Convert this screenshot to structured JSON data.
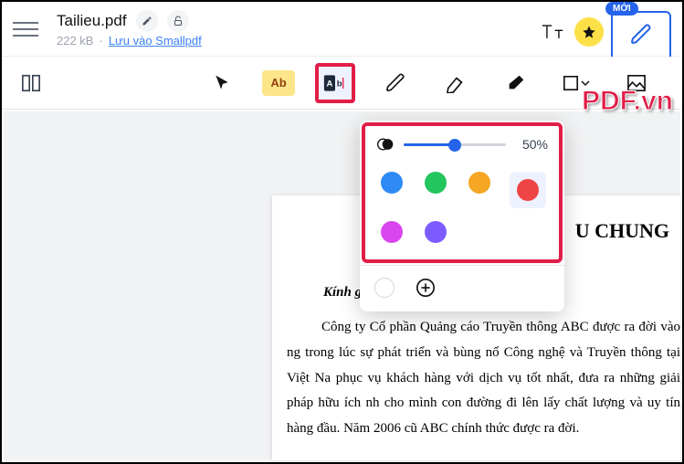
{
  "header": {
    "filename": "Tailieu.pdf",
    "filesize": "222 kB",
    "save_link": "Lưu vào Smallpdf",
    "new_badge": "MỚI"
  },
  "toolbar": {
    "highlight_label": "Ab"
  },
  "popover": {
    "opacity_value": "50%",
    "colors": {
      "blue": "#2f8af5",
      "green": "#22c55e",
      "orange": "#f5a623",
      "red": "#ef4444",
      "magenta": "#d946ef",
      "purple": "#7c5cff"
    },
    "selected_color": "red"
  },
  "document": {
    "heading": "U CHUNG",
    "greeting": "Kính gửi Quý khách hàng!",
    "body": "Công ty Cổ phần Quảng cáo Truyền thông ABC được ra đời vào ng trong lúc sự phát triển và bùng nổ Công nghệ và Truyền thông tại Việt Na phục vụ khách hàng với dịch vụ tốt nhất, đưa ra những giải pháp hữu ích nh cho mình con đường đi lên lấy chất lượng và uy tín hàng đầu. Năm 2006 cũ ABC chính thức được ra đời."
  },
  "watermark": "PDF.vn"
}
